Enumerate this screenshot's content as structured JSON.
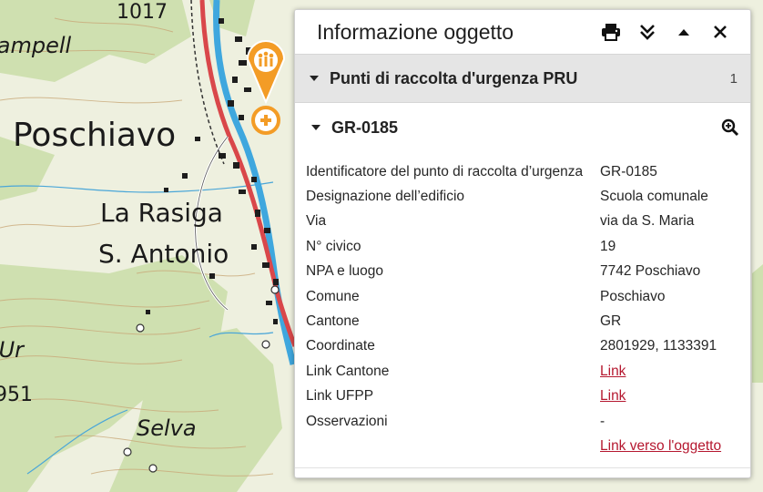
{
  "map": {
    "labels": {
      "place1": "Poschiavo",
      "place2": "La Rasiga",
      "place3": "S. Antonio",
      "place4": "Selva",
      "place5": "Campell",
      "frag_ur": "'Ur",
      "frag_951": "951",
      "elev_1017": "1017"
    },
    "colors": {
      "forest": "#cfe0b0",
      "open": "#eef0df",
      "road": "#d9474a",
      "river": "#3fa7de",
      "marker": "#f39c26"
    }
  },
  "panel": {
    "title": "Informazione oggetto",
    "tools": [
      "printer-icon",
      "collapse-all-icon",
      "minimize-icon",
      "close-icon"
    ],
    "section": {
      "title": "Punti di raccolta d'urgenza PRU",
      "count": "1"
    },
    "feature": {
      "id": "GR-0185"
    },
    "rows": [
      {
        "key": "Identificatore del punto di raccolta d’urgenza",
        "value": "GR-0185"
      },
      {
        "key": "Designazione dell’edificio",
        "value": "Scuola comunale"
      },
      {
        "key": "Via",
        "value": "via da S. Maria"
      },
      {
        "key": "N° civico",
        "value": "19"
      },
      {
        "key": "NPA e luogo",
        "value": "7742 Poschiavo"
      },
      {
        "key": "Comune",
        "value": "Poschiavo"
      },
      {
        "key": "Cantone",
        "value": "GR"
      },
      {
        "key": "Coordinate",
        "value": "2801929, 1133391"
      },
      {
        "key": "Link Cantone",
        "value": "Link"
      },
      {
        "key": "Link UFPP",
        "value": "Link"
      },
      {
        "key": "Osservazioni",
        "value": "-"
      }
    ],
    "object_link": "Link verso l'oggetto"
  }
}
